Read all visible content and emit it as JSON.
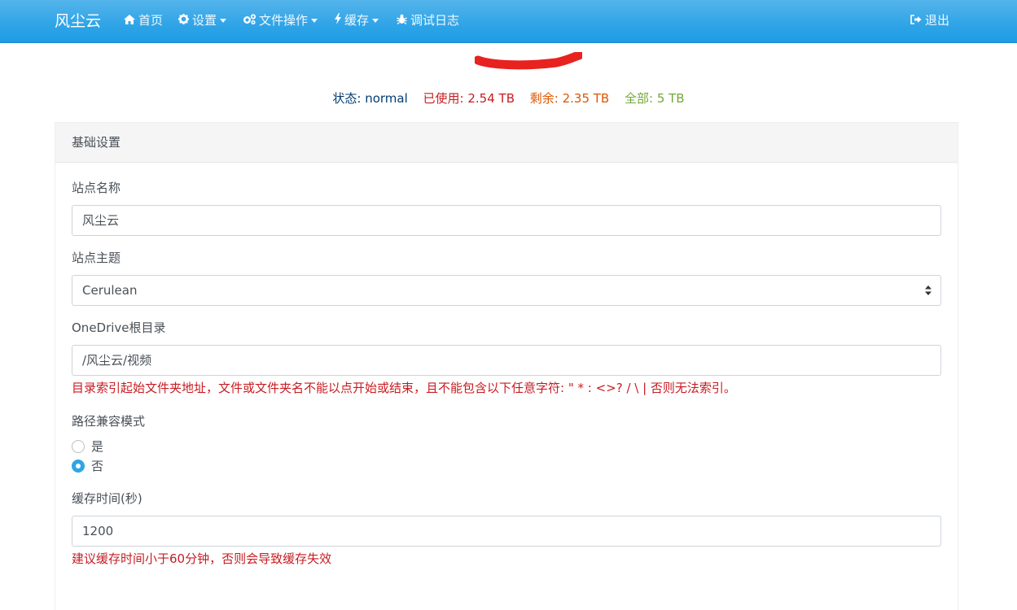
{
  "navbar": {
    "brand": "风尘云",
    "items": [
      {
        "label": "首页",
        "icon": "home-icon"
      },
      {
        "label": "设置",
        "icon": "gear-icon",
        "dropdown": true
      },
      {
        "label": "文件操作",
        "icon": "gears-icon",
        "dropdown": true
      },
      {
        "label": "缓存",
        "icon": "bolt-icon",
        "dropdown": true
      },
      {
        "label": "调试日志",
        "icon": "bug-icon"
      }
    ],
    "logout": {
      "label": "退出",
      "icon": "sign-out-icon"
    }
  },
  "status": {
    "state": "状态: normal",
    "used": "已使用: 2.54 TB",
    "remaining": "剩余: 2.35 TB",
    "total": "全部: 5 TB",
    "colors": {
      "state": "#033c73",
      "used": "#c71c22",
      "remaining": "#dd5600",
      "total": "#73a839"
    }
  },
  "card": {
    "header": "基础设置",
    "site_name": {
      "label": "站点名称",
      "value": "风尘云"
    },
    "site_theme": {
      "label": "站点主题",
      "value": "Cerulean"
    },
    "root_dir": {
      "label": "OneDrive根目录",
      "value": "/风尘云/视频",
      "help": "目录索引起始文件夹地址，文件或文件夹名不能以点开始或结束，且不能包含以下任意字符: \" * : <>? / \\ | 否则无法索引。"
    },
    "path_compat": {
      "label": "路径兼容模式",
      "options": [
        {
          "label": "是",
          "checked": false
        },
        {
          "label": "否",
          "checked": true
        }
      ]
    },
    "cache_time": {
      "label": "缓存时间(秒)",
      "value": "1200",
      "help": "建议缓存时间小于60分钟，否则会导致缓存失效"
    }
  }
}
